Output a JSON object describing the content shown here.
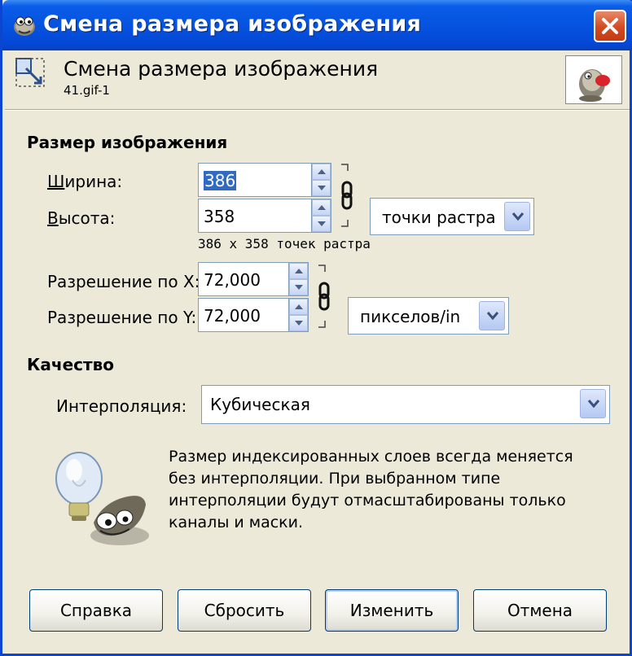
{
  "window": {
    "title": "Смена размера изображения"
  },
  "header": {
    "title": "Смена размера изображения",
    "subtitle": "41.gif-1"
  },
  "image_size": {
    "section_title": "Размер изображения",
    "width_label": "Ширина:",
    "width_value": "386",
    "height_label": "Высота:",
    "height_value": "358",
    "size_units": "точки растра",
    "size_info": "386 x 358 точек растра"
  },
  "resolution": {
    "x_label": "Разрешение по X:",
    "x_value": "72,000",
    "y_label": "Разрешение по Y:",
    "y_value": "72,000",
    "units": "пикселов/in"
  },
  "quality": {
    "section_title": "Качество",
    "interpolation_label": "Интерполяция:",
    "interpolation_value": "Кубическая"
  },
  "info_text": "Размер индексированных слоев всегда меняется без интерполяции. При выбранном типе интерполяции будут отмасштабированы только каналы и маски.",
  "buttons": {
    "help": "Справка",
    "reset": "Сбросить",
    "resize": "Изменить",
    "cancel": "Отмена"
  },
  "colors": {
    "titlebar": "#0553e0",
    "close": "#d24a22",
    "selection": "#316ac5",
    "dialog_bg": "#ece9d8"
  }
}
